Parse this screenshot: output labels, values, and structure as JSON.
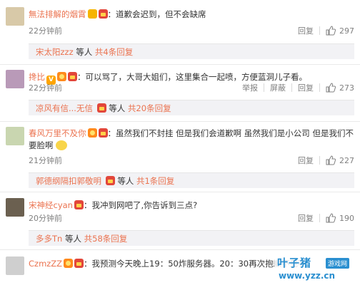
{
  "comments": [
    {
      "name": "無法排解的烟霄",
      "text": "：道歉会迟到，但不会缺席",
      "time": "22分钟前",
      "actions": [
        "回复"
      ],
      "likes": "297",
      "reply_user": "宋太阳zzz",
      "reply_suffix": "等人",
      "reply_total": "共4条回复",
      "avatar_color": "#d8c9a8"
    },
    {
      "name": "搀比",
      "text": "：可以骂了，大哥大姐们，这里集合一起喷，方便蓝洞儿子看。",
      "time": "22分钟前",
      "actions": [
        "举报",
        "屏蔽",
        "回复"
      ],
      "likes": "273",
      "reply_user": "凉风有信...无信",
      "reply_suffix": "等人",
      "reply_total": "共20条回复",
      "avatar_color": "#b99ab8"
    },
    {
      "name": "春风万里不及你",
      "text": "：虽然我们不封挂 但是我们会道歉啊 虽然我们是小公司 但是我们不要脸啊",
      "time": "21分钟前",
      "actions": [
        "回复"
      ],
      "likes": "227",
      "reply_user": "郭德纲隔扣郭敬明",
      "reply_suffix": "等人",
      "reply_total": "共1条回复",
      "avatar_color": "#c9d6b0"
    },
    {
      "name": "宋神经cyan",
      "text": "：我冲到网吧了,你告诉到三点?",
      "time": "20分钟前",
      "actions": [
        "回复"
      ],
      "likes": "190",
      "reply_user": "多多Tn",
      "reply_suffix": "等人",
      "reply_total": "共58条回复",
      "avatar_color": "#6b6050"
    },
    {
      "name": "CzmzZZ",
      "text": "：我预测今天晚上19：50炸服务器。20：30再次抱歉不见不",
      "time": "",
      "actions": [],
      "likes": "",
      "avatar_color": "#cfcfcf"
    }
  ],
  "watermark": {
    "title": "叶子猪",
    "sub": "游戏网",
    "url": "www.yzz.cn"
  }
}
